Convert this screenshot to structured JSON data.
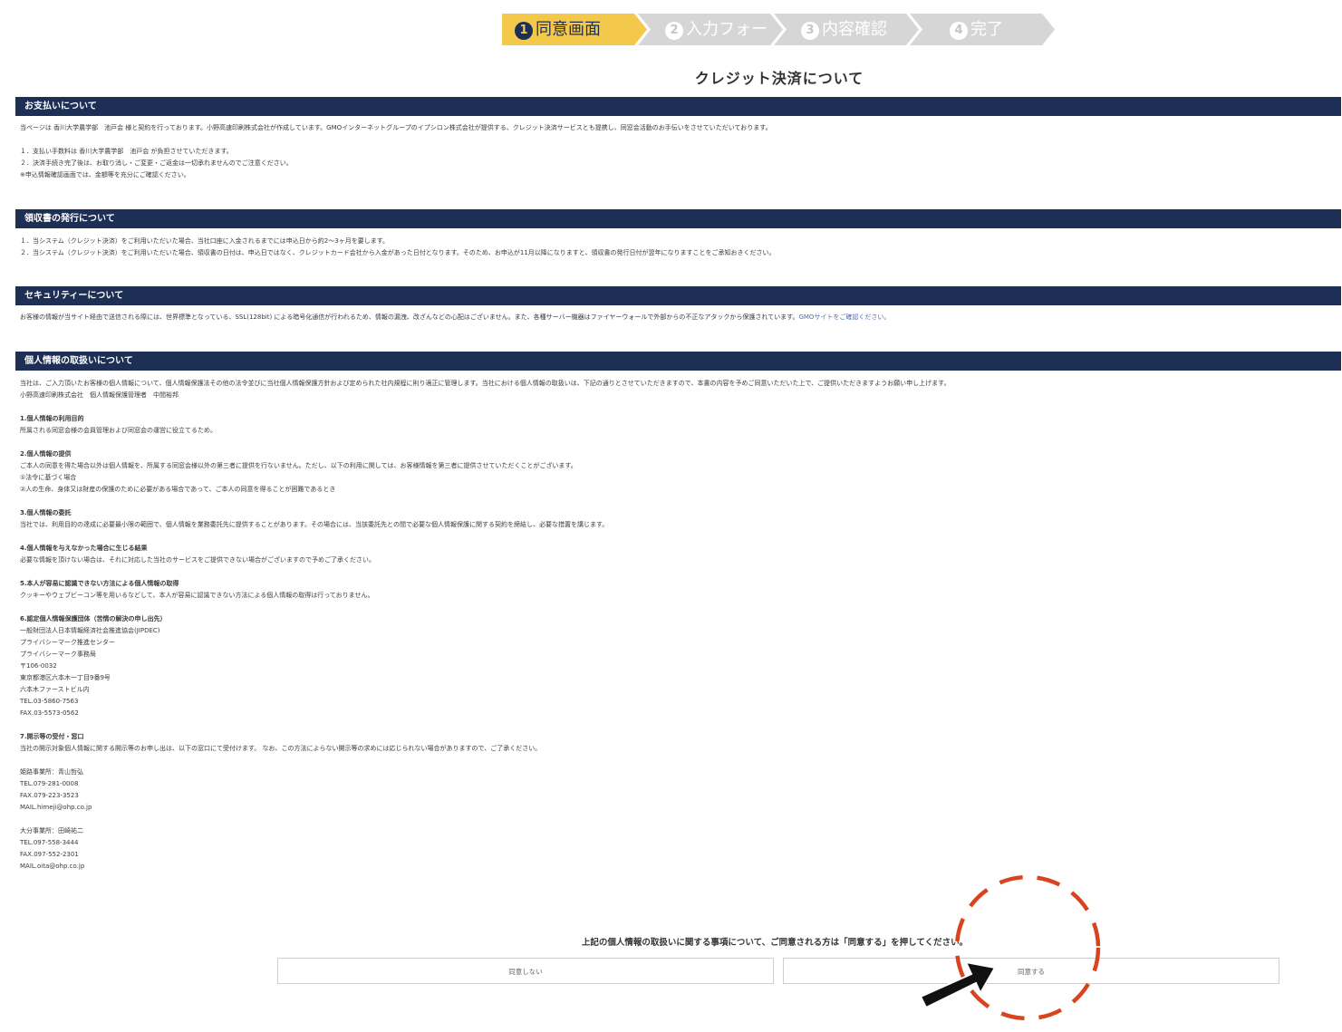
{
  "steps": [
    {
      "num": "1",
      "label": "同意画面"
    },
    {
      "num": "2",
      "label": "入力フォーム"
    },
    {
      "num": "3",
      "label": "内容確認"
    },
    {
      "num": "4",
      "label": "完了"
    }
  ],
  "page_title": "クレジット決済について",
  "sections": {
    "payment": {
      "title": "お支払いについて",
      "intro": "当ページは 香川大学農学部　池戸会 様と契約を行っております。小野高速印刷株式会社が作成しています。GMOインターネットグループのイプシロン株式会社が提供する、クレジット決済サービスとも提携し、同窓会活動のお手伝いをさせていただいております。",
      "item1": "１．支払い手数料は 香川大学農学部　池戸会 が負担させていただきます。",
      "item2": "２．決済手続き完了後は、お取り消し・ご変更・ご返金は一切承れませんのでご注意ください。",
      "note": "※申込情報確認画面では、金額等を充分にご確認ください。"
    },
    "receipt": {
      "title": "領収書の発行について",
      "item1": "１．当システム（クレジット決済）をご利用いただいた場合、当社口座に入金されるまでには申込日から約2～3ヶ月を要します。",
      "item2": "２．当システム（クレジット決済）をご利用いただいた場合、領収書の日付は、申込日ではなく、クレジットカード会社から入金があった日付となります。そのため、お申込が11月以降になりますと、領収書の発行日付が翌年になりますことをご承知おきください。"
    },
    "security": {
      "title": "セキュリティーについて",
      "text": "お客様の情報が当サイト経由で送信される際には、世界標準となっている、SSL(128bit) による暗号化通信が行われるため、情報の漏洩、改ざんなどの心配はございません。また、各種サーバー機器はファイヤーウォールで外部からの不正なアタックから保護されています。",
      "link": "GMOサイトをご確認ください。"
    },
    "privacy": {
      "title": "個人情報の取扱いについて",
      "intro": "当社は、ご入力頂いたお客様の個人情報について、個人情報保護法その他の法令並びに当社個人情報保護方針および定められた社内規程に則り適正に管理します。当社における個人情報の取扱いは、下記の通りとさせていただきますので、本書の内容を予めご同意いただいた上で、ご提供いただきますようお願い申し上げます。",
      "manager": "小野高速印刷株式会社　個人情報保護管理者　中間裕邦",
      "h1": "1.個人情報の利用目的",
      "t1": "所属される同窓会様の会員管理および同窓会の運営に役立てるため。",
      "h2": "2.個人情報の提供",
      "t2a": "ご本人の同意を得た場合以外は個人情報を、所属する同窓会様以外の第三者に提供を行ないません。ただし、以下の利用に関しては、お客様情報を第三者に提供させていただくことがございます。",
      "t2b": "①法令に基づく場合",
      "t2c": "②人の生命、身体又は財産の保護のために必要がある場合であって、ご本人の同意を得ることが困難であるとき",
      "h3": "3.個人情報の委託",
      "t3": "当社では、利用目的の達成に必要最小限の範囲で、個人情報を業務委託先に提供することがあります。その場合には、当該委託先との間で必要な個人情報保護に関する契約を締結し、必要な措置を講じます。",
      "h4": "4.個人情報を与えなかった場合に生じる結果",
      "t4": "必要な情報を頂けない場合は、それに対応した当社のサービスをご提供できない場合がございますので予めご了承ください。",
      "h5": "5.本人が容易に認識できない方法による個人情報の取得",
      "t5": "クッキーやウェブビーコン等を用いるなどして、本人が容易に認識できない方法による個人情報の取得は行っておりません。",
      "h6": "6.認定個人情報保護団体（苦情の解決の申し出先）",
      "t6": [
        "一般財団法人日本情報経済社会推進協会(JIPDEC)",
        "プライバシーマーク推進センター",
        "プライバシーマーク事務局",
        "〒106-0032",
        "東京都港区六本木一丁目9番9号",
        "六本木ファーストビル内",
        "TEL.03-5860-7563",
        "FAX.03-5573-0562"
      ],
      "h7": "7.開示等の受付・窓口",
      "t7": "当社の開示対象個人情報に関する開示等のお申し出は、以下の窓口にて受付けます。 なお、この方法によらない開示等の求めには応じられない場合がありますので、ご了承ください。",
      "himeji": [
        "姫路事業所：青山哲弘",
        "TEL.079-281-0008",
        "FAX.079-223-3523",
        "MAIL.himeji@ohp.co.jp"
      ],
      "oita": [
        "大分事業所：田崎祐二",
        "TEL.097-558-3444",
        "FAX.097-552-2301",
        "MAIL.oita@ohp.co.jp"
      ]
    }
  },
  "consent": {
    "note": "上記の個人情報の取扱いに関する事項について、ご同意される方は「同意する」を押してください。",
    "disagree": "同意しない",
    "agree": "同意する"
  },
  "colors": {
    "navy": "#1e2f55",
    "active_step": "#f4c84a",
    "inactive_step": "#d6d6d6",
    "annotation": "#d9441f"
  }
}
